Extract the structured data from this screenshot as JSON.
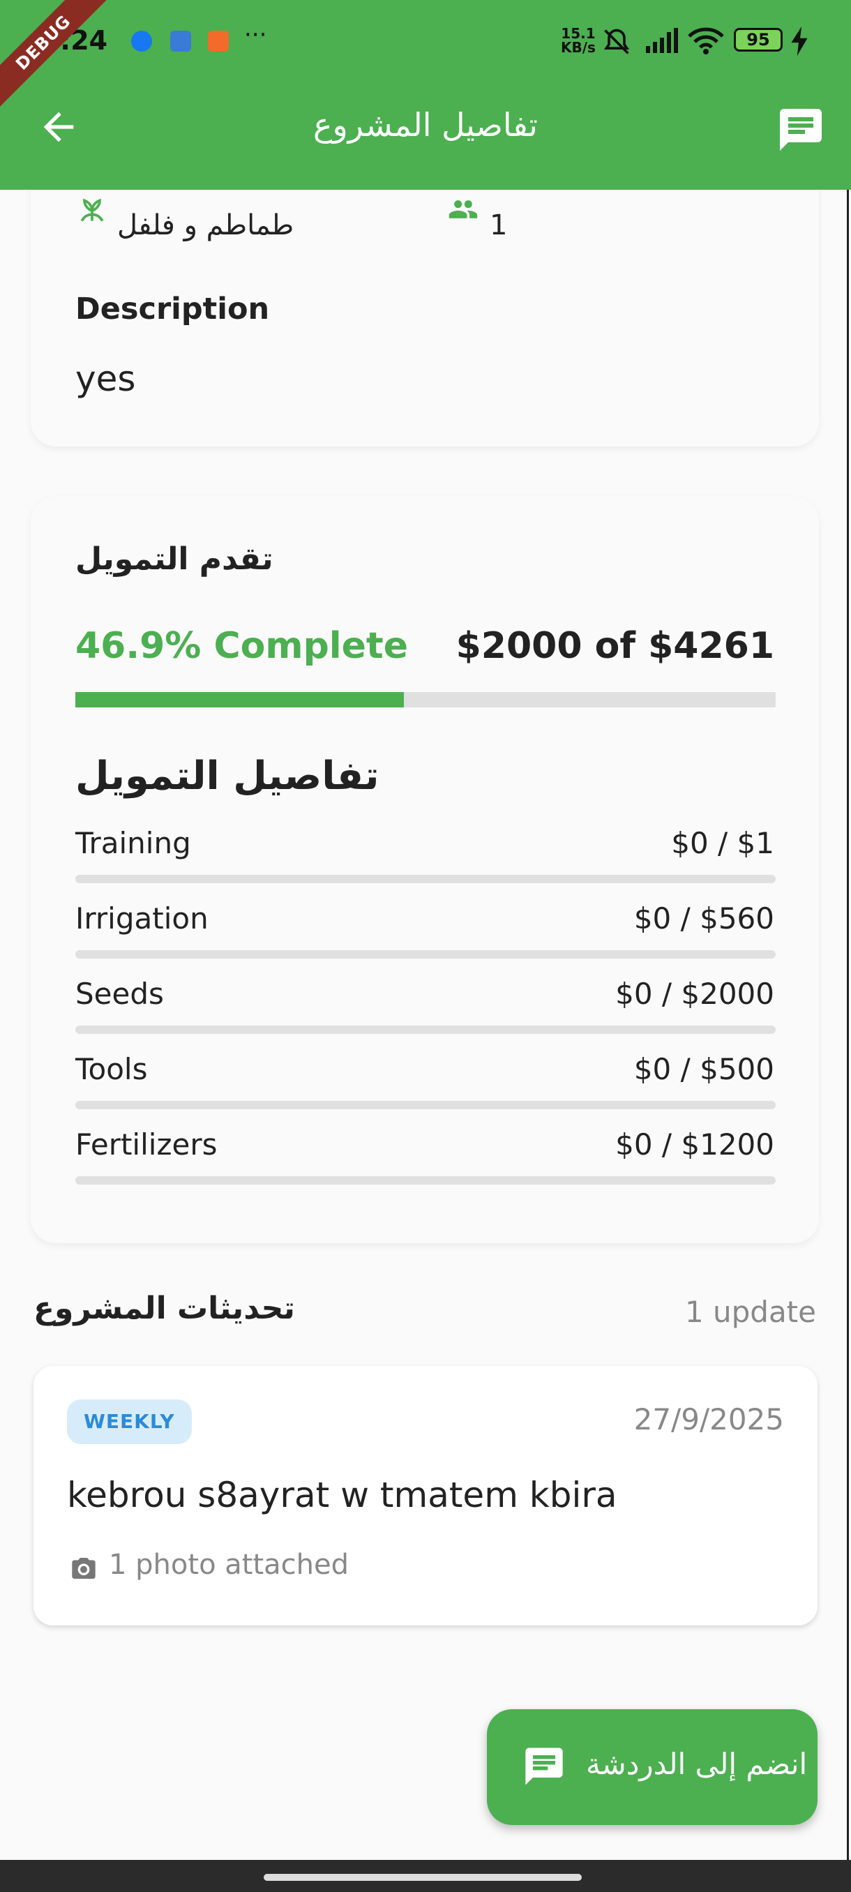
{
  "status_bar": {
    "time": ":24",
    "net_speed_value": "15.1",
    "net_speed_unit": "KB/s",
    "battery": "95",
    "more": "···"
  },
  "debug_banner": "DEBUG",
  "app_bar": {
    "title": "تفاصيل المشروع"
  },
  "project_info": {
    "crop_value": "طماطم و فلفل",
    "count_value": "1",
    "description_label": "Description",
    "description": "yes"
  },
  "funding": {
    "section_title": "تقدم التمويل",
    "percent_complete": "46.9% Complete",
    "amount_text": "$2000 of $4261",
    "progress_fraction": 0.469,
    "details_title": "تفاصيل التمويل",
    "items": [
      {
        "label": "Training",
        "value": "$0 / $1",
        "progress": 0
      },
      {
        "label": "Irrigation",
        "value": "$0 / $560",
        "progress": 0
      },
      {
        "label": "Seeds",
        "value": "$0 / $2000",
        "progress": 0
      },
      {
        "label": "Tools",
        "value": "$0 / $500",
        "progress": 0
      },
      {
        "label": "Fertilizers",
        "value": "$0 / $1200",
        "progress": 0
      }
    ]
  },
  "updates": {
    "title": "تحديثات المشروع",
    "count": "1 update",
    "items": [
      {
        "badge": "WEEKLY",
        "date": "27/9/2025",
        "text": "kebrou s8ayrat w tmatem kbira",
        "photos": "1 photo attached"
      }
    ]
  },
  "fab": {
    "label": "انضم إلى الدردشة"
  },
  "colors": {
    "primary": "#4caf50",
    "badge_bg": "#d7ecfa",
    "badge_text": "#2b8bd8"
  }
}
